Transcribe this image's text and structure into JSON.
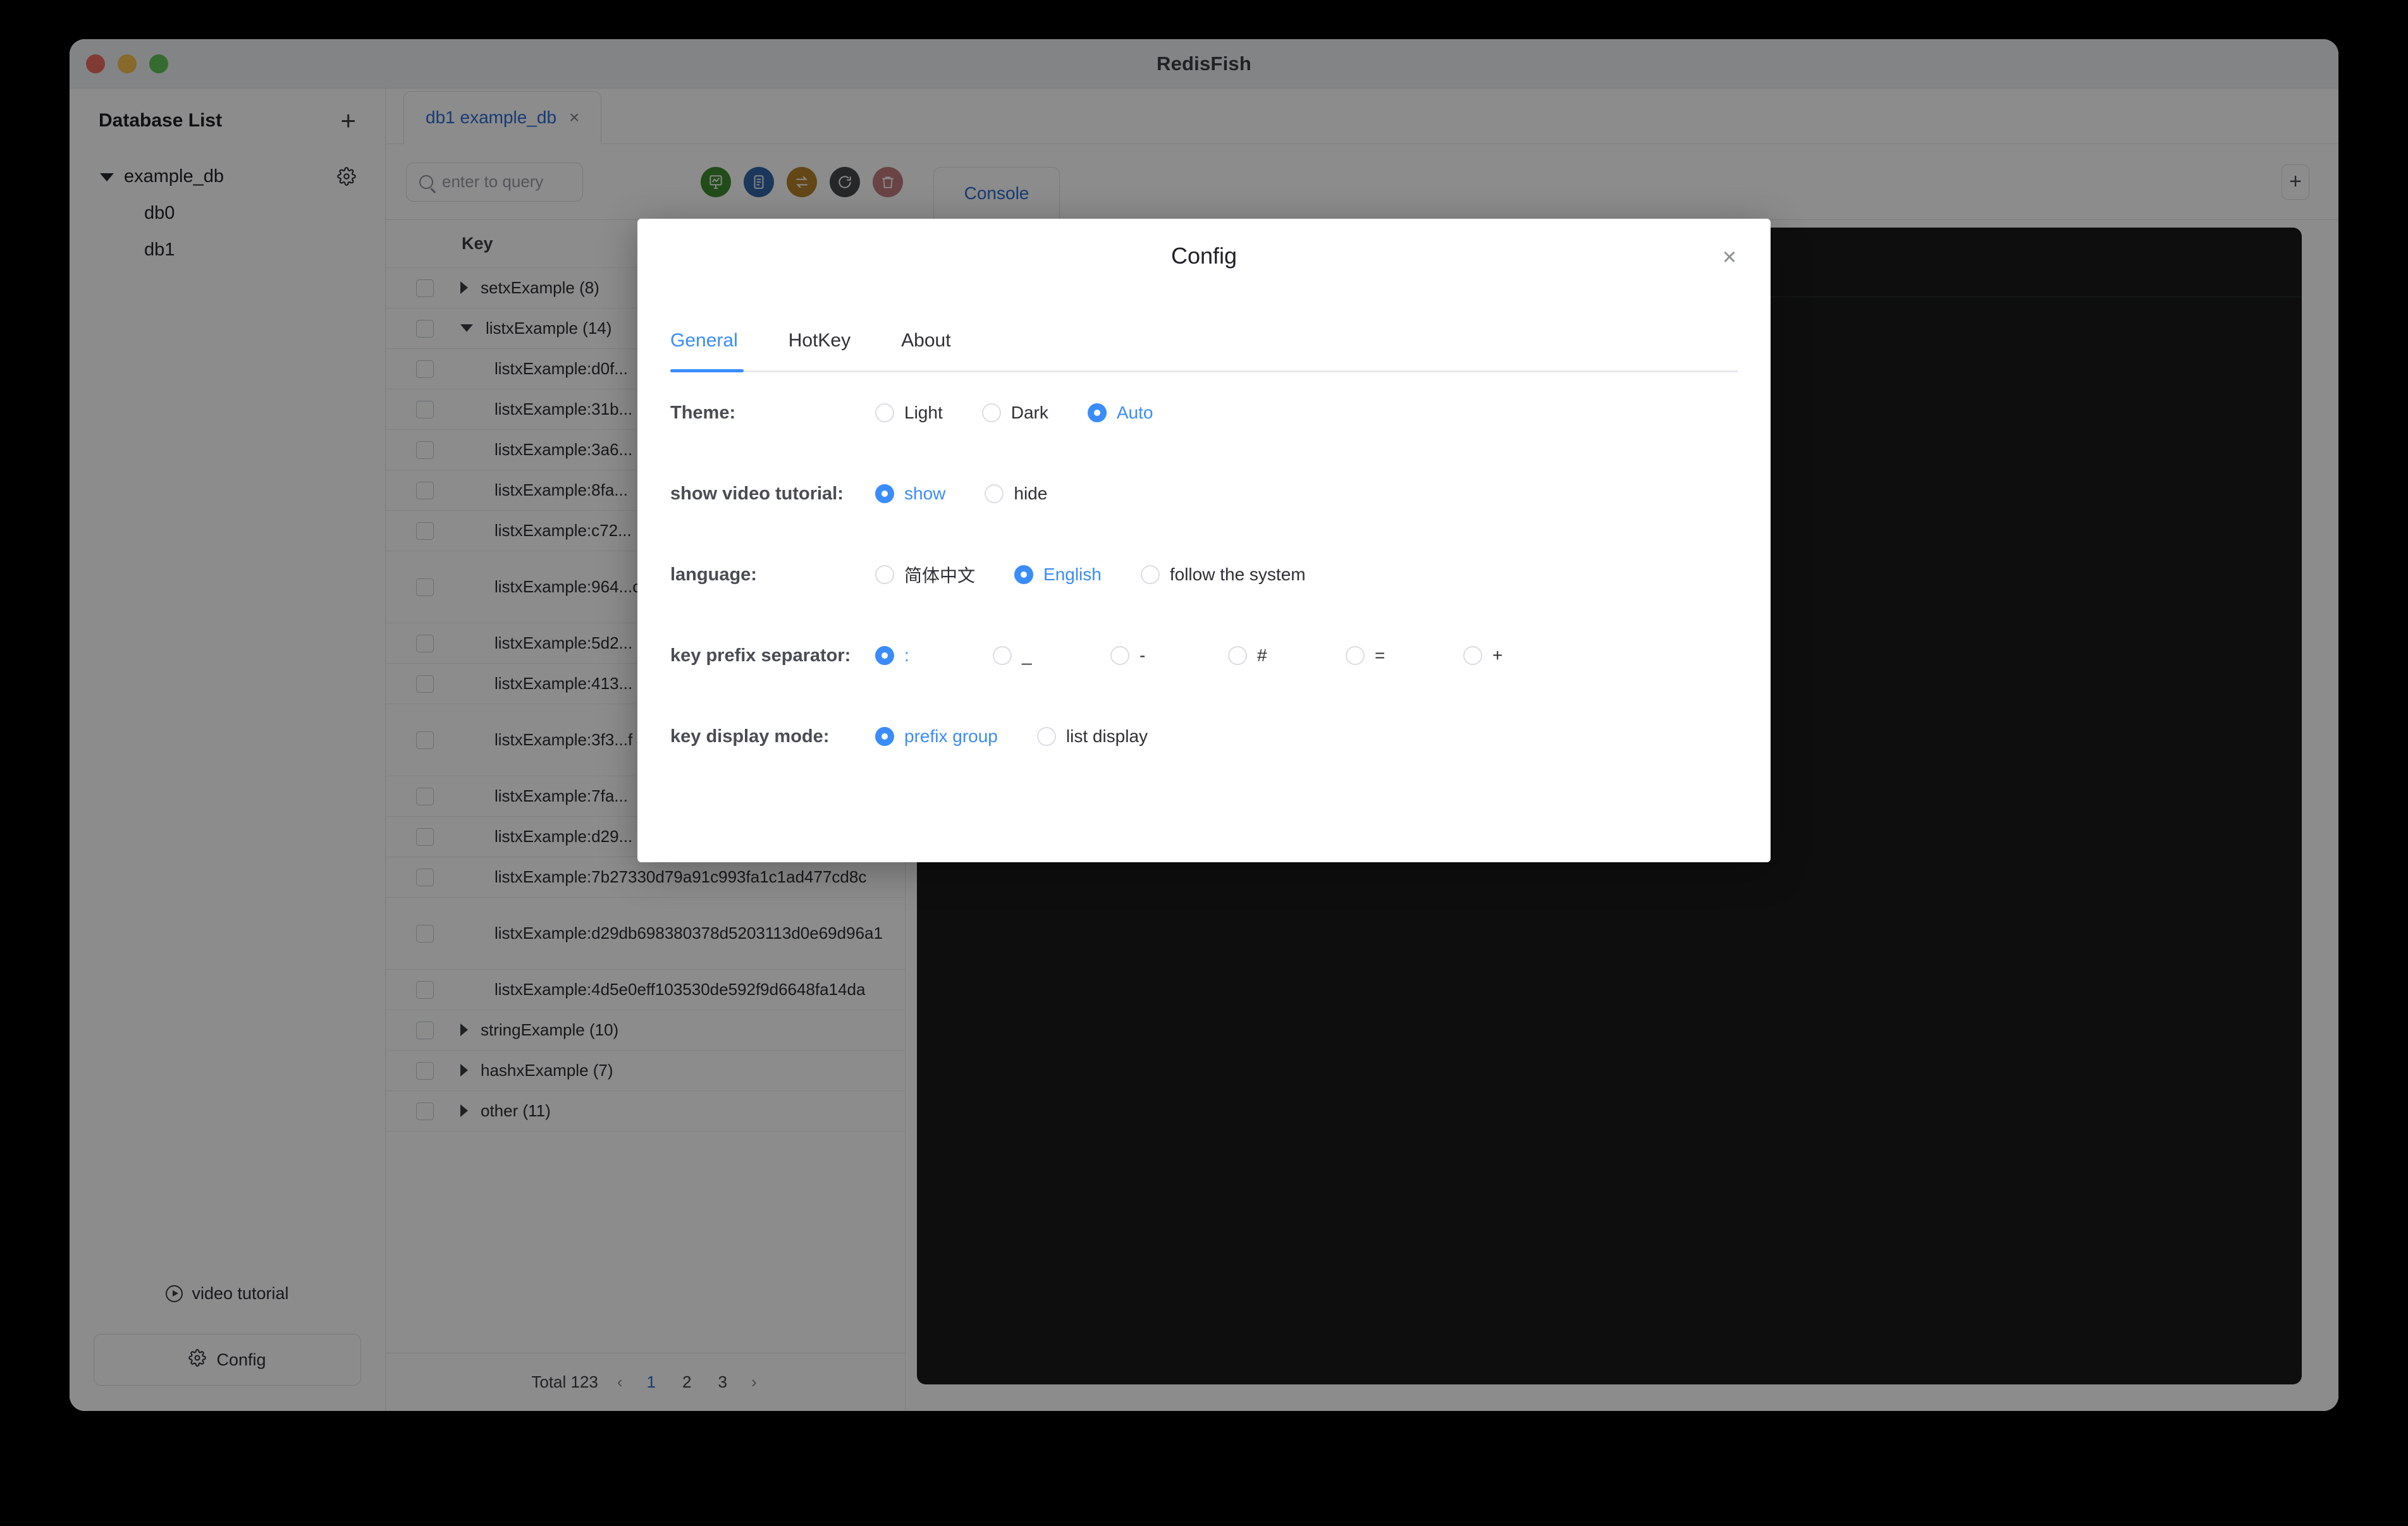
{
  "window": {
    "title": "RedisFish",
    "traffic_lights": [
      "close",
      "minimize",
      "zoom"
    ]
  },
  "sidebar": {
    "title": "Database List",
    "add_label": "+",
    "tree": {
      "group_label": "example_db",
      "items": [
        {
          "label": "db0"
        },
        {
          "label": "db1"
        }
      ]
    },
    "video_tutorial_label": "video tutorial",
    "config_label": "Config"
  },
  "main": {
    "tab": {
      "label": "db1 example_db",
      "close": "×"
    },
    "search": {
      "placeholder": "enter to query",
      "value": ""
    },
    "tool_icons": [
      {
        "name": "chart-board-icon",
        "color": "#3e8b2e"
      },
      {
        "name": "list-document-icon",
        "color": "#3465a8"
      },
      {
        "name": "flow-transfer-icon",
        "color": "#b5812a"
      },
      {
        "name": "refresh-icon",
        "color": "#46474b"
      },
      {
        "name": "trash-icon",
        "color": "#c17b7f"
      }
    ],
    "console_tab_label": "Console",
    "add_panel_label": "+"
  },
  "key_panel": {
    "header": "Key",
    "rows": [
      {
        "label": "setxExample (8)",
        "type": "group",
        "expanded": false
      },
      {
        "label": "listxExample (14)",
        "type": "group",
        "expanded": true
      },
      {
        "label": "listxExample:d0f...",
        "type": "leaf",
        "tall": false
      },
      {
        "label": "listxExample:31b...",
        "type": "leaf",
        "tall": false
      },
      {
        "label": "listxExample:3a6...",
        "type": "leaf",
        "tall": false
      },
      {
        "label": "listxExample:8fa...",
        "type": "leaf",
        "tall": false
      },
      {
        "label": "listxExample:c72...",
        "type": "leaf",
        "tall": false
      },
      {
        "label": "listxExample:964...c",
        "type": "leaf",
        "tall": true
      },
      {
        "label": "listxExample:5d2...",
        "type": "leaf",
        "tall": false
      },
      {
        "label": "listxExample:413...",
        "type": "leaf",
        "tall": false
      },
      {
        "label": "listxExample:3f3...f",
        "type": "leaf",
        "tall": true
      },
      {
        "label": "listxExample:7fa...",
        "type": "leaf",
        "tall": false
      },
      {
        "label": "listxExample:d29...",
        "type": "leaf",
        "tall": false
      },
      {
        "label": "listxExample:7b27330d79a91c993fa1c1ad477cd8c",
        "type": "leaf",
        "tall": false
      },
      {
        "label": "listxExample:d29db698380378d5203113d0e69d96a1",
        "type": "leaf",
        "tall": true
      },
      {
        "label": "listxExample:4d5e0eff103530de592f9d6648fa14da",
        "type": "leaf",
        "tall": false
      },
      {
        "label": "stringExample (10)",
        "type": "group",
        "expanded": false
      },
      {
        "label": "hashxExample (7)",
        "type": "group",
        "expanded": false
      },
      {
        "label": "other (11)",
        "type": "group",
        "expanded": false
      }
    ],
    "footer": {
      "total_label": "Total 123",
      "prev": "‹",
      "next": "›",
      "pages": [
        "1",
        "2",
        "3"
      ],
      "current_page": "1"
    }
  },
  "modal": {
    "title": "Config",
    "close": "×",
    "tabs": [
      {
        "label": "General",
        "active": true
      },
      {
        "label": "HotKey",
        "active": false
      },
      {
        "label": "About",
        "active": false
      }
    ],
    "rows": [
      {
        "label": "Theme:",
        "name": "theme",
        "options": [
          {
            "label": "Light",
            "selected": false
          },
          {
            "label": "Dark",
            "selected": false
          },
          {
            "label": "Auto",
            "selected": true
          }
        ]
      },
      {
        "label": "show video tutorial:",
        "name": "show-video-tutorial",
        "options": [
          {
            "label": "show",
            "selected": true
          },
          {
            "label": "hide",
            "selected": false
          }
        ]
      },
      {
        "label": "language:",
        "name": "language",
        "options": [
          {
            "label": "简体中文",
            "selected": false
          },
          {
            "label": "English",
            "selected": true
          },
          {
            "label": "follow the system",
            "selected": false
          }
        ]
      },
      {
        "label": "key prefix separator:",
        "name": "key-prefix-separator",
        "options": [
          {
            "label": ":",
            "selected": true
          },
          {
            "label": "_",
            "selected": false
          },
          {
            "label": "-",
            "selected": false
          },
          {
            "label": "#",
            "selected": false
          },
          {
            "label": "=",
            "selected": false
          },
          {
            "label": "+",
            "selected": false
          }
        ]
      },
      {
        "label": "key display mode:",
        "name": "key-display-mode",
        "options": [
          {
            "label": "prefix group",
            "selected": true
          },
          {
            "label": "list display",
            "selected": false
          }
        ]
      }
    ]
  },
  "colors": {
    "accent": "#3a8cfb",
    "link": "#2b6cd4",
    "console_bg": "#1a1a1a",
    "titlebar_bg": "#eff0f3"
  }
}
